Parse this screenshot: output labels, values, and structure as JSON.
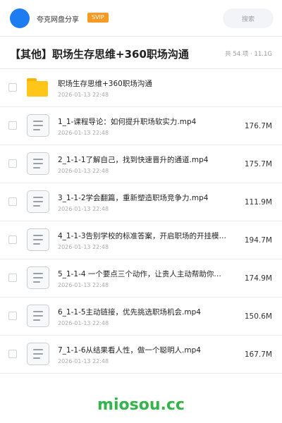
{
  "topbar": {
    "app_name": "夸克网盘分享",
    "badge": "SVIP",
    "search_placeholder": "搜索",
    "avatar_color": "#1e7cf2",
    "badge_color": "#f59a23"
  },
  "folder": {
    "title": "【其他】职场生存思维+360职场沟通",
    "meta": "共 54 项 · 11.1G"
  },
  "items": [
    {
      "type": "folder",
      "icon": "folder-icon",
      "name": "职场生存思维+360职场沟通",
      "date": "2026-01-13 22:48",
      "size": ""
    },
    {
      "type": "file",
      "icon": "file-icon",
      "name": "1_1-课程导论：如何提升职场软实力.mp4",
      "date": "2026-01-13 22:48",
      "size": "176.7M"
    },
    {
      "type": "file",
      "icon": "file-icon",
      "name": "2_1-1-1了解自己，找到快速晋升的通道.mp4",
      "date": "2026-01-13 22:48",
      "size": "175.7M"
    },
    {
      "type": "file",
      "icon": "file-icon",
      "name": "3_1-1-2学会翻篇，重新塑造职场竞争力.mp4",
      "date": "2026-01-13 22:48",
      "size": "111.9M"
    },
    {
      "type": "file",
      "icon": "file-icon",
      "name": "4_1-1-3告别学校的标准答案，开启职场的开挂模…",
      "date": "2026-01-13 22:48",
      "size": "194.7M"
    },
    {
      "type": "file",
      "icon": "file-icon",
      "name": "5_1-1-4 一个要点三个动作，让贵人主动帮助你…",
      "date": "2026-01-13 22:48",
      "size": "174.9M"
    },
    {
      "type": "file",
      "icon": "file-icon",
      "name": "6_1-1-5主动链接，优先挑选职场机会.mp4",
      "date": "2026-01-13 22:48",
      "size": "150.6M"
    },
    {
      "type": "file",
      "icon": "file-icon",
      "name": "7_1-1-6从结果看人性，做一个聪明人.mp4",
      "date": "2026-01-13 22:48",
      "size": "167.7M"
    }
  ],
  "watermark": "miosou.cc"
}
